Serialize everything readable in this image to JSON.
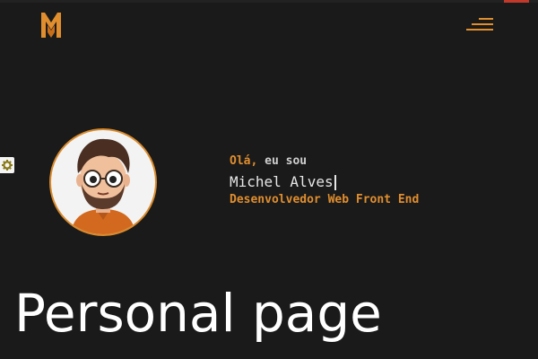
{
  "header": {
    "logo_icon": "mm-monogram-logo",
    "menu_icon": "hamburger-menu-icon",
    "accent": "#e08e2e"
  },
  "sidebar_widget": {
    "icon": "gear-icon"
  },
  "hero": {
    "greeting_ola": "Olá,",
    "greeting_rest": " eu sou",
    "name": "Michel Alves",
    "role": "Desenvolvedor Web Front End",
    "avatar_icon": "cartoon-avatar"
  },
  "caption": "Personal page"
}
